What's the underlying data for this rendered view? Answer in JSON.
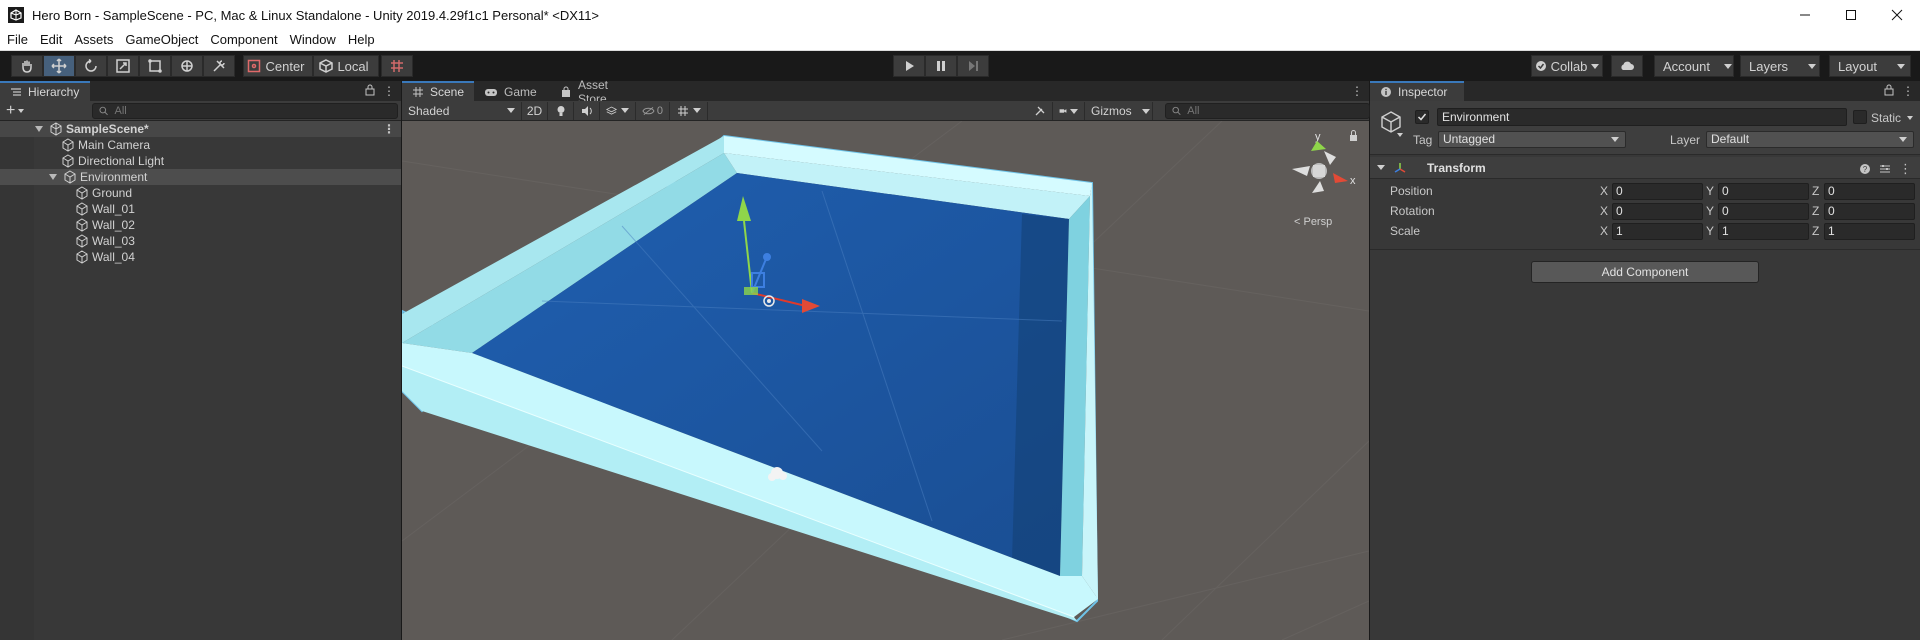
{
  "window": {
    "title": "Hero Born - SampleScene - PC, Mac & Linux Standalone - Unity 2019.4.29f1c1 Personal* <DX11>"
  },
  "menu": [
    "File",
    "Edit",
    "Assets",
    "GameObject",
    "Component",
    "Window",
    "Help"
  ],
  "toolbar": {
    "pivot_mode": "Center",
    "pivot_rotation": "Local",
    "collab": "Collab",
    "account": "Account",
    "layers": "Layers",
    "layout": "Layout"
  },
  "hierarchy": {
    "tab": "Hierarchy",
    "search_placeholder": "All",
    "scene": "SampleScene*",
    "items": [
      {
        "label": "Main Camera",
        "depth": 1
      },
      {
        "label": "Directional Light",
        "depth": 1
      },
      {
        "label": "Environment",
        "depth": 1,
        "expanded": true,
        "selected": true
      },
      {
        "label": "Ground",
        "depth": 2
      },
      {
        "label": "Wall_01",
        "depth": 2
      },
      {
        "label": "Wall_02",
        "depth": 2
      },
      {
        "label": "Wall_03",
        "depth": 2
      },
      {
        "label": "Wall_04",
        "depth": 2
      }
    ]
  },
  "scene": {
    "tabs": [
      "Scene",
      "Game",
      "Asset Store"
    ],
    "shading": "Shaded",
    "mode_2d": "2D",
    "hidden_count": "0",
    "gizmos": "Gizmos",
    "search_placeholder": "All",
    "projection": "< Persp",
    "axis_y": "y",
    "axis_x": "x"
  },
  "inspector": {
    "tab": "Inspector",
    "object_name": "Environment",
    "static_label": "Static",
    "tag_label": "Tag",
    "tag_value": "Untagged",
    "layer_label": "Layer",
    "layer_value": "Default",
    "component": "Transform",
    "position_label": "Position",
    "rotation_label": "Rotation",
    "scale_label": "Scale",
    "axes": [
      "X",
      "Y",
      "Z"
    ],
    "position": [
      "0",
      "0",
      "0"
    ],
    "rotation": [
      "0",
      "0",
      "0"
    ],
    "scale": [
      "1",
      "1",
      "1"
    ],
    "add_component": "Add Component"
  }
}
